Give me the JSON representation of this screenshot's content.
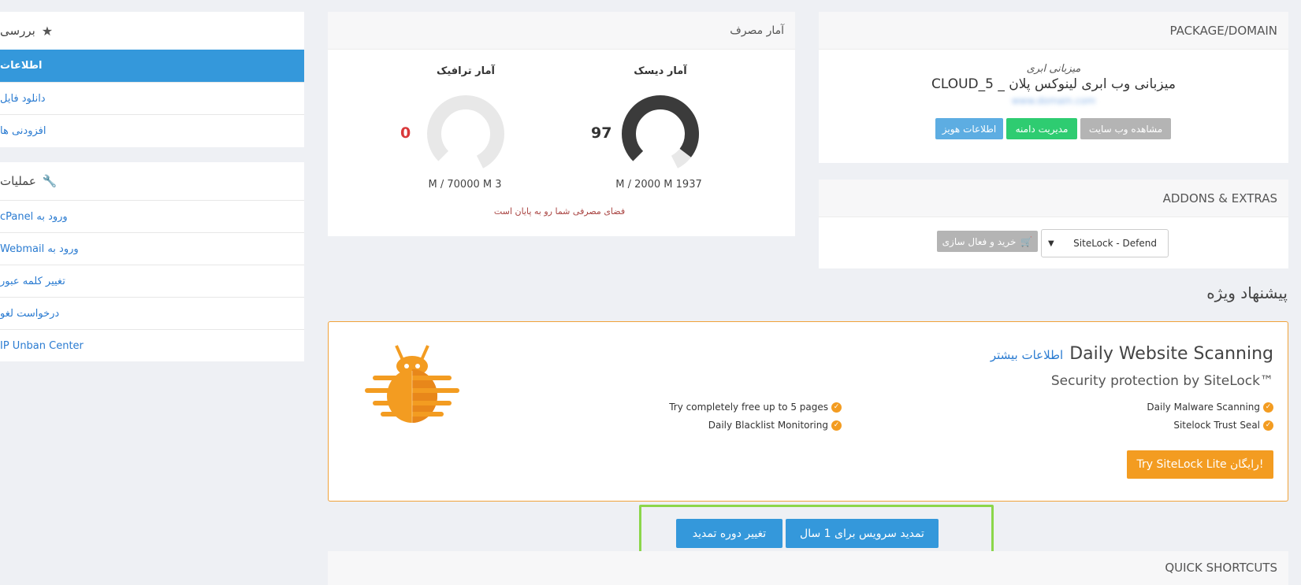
{
  "sidebar": {
    "overview_title": "بررسی",
    "overview_items": [
      {
        "label": "اطلاعات",
        "active": true
      },
      {
        "label": "دانلود فایل",
        "active": false
      },
      {
        "label": "افزودنی ها",
        "active": false
      }
    ],
    "actions_title": "عملیات",
    "action_items": [
      {
        "label": "ورود به cPanel"
      },
      {
        "label": "ورود به Webmail"
      },
      {
        "label": "تغییر کلمه عبور"
      },
      {
        "label": "درخواست لغو"
      },
      {
        "label": "IP Unban Center"
      }
    ]
  },
  "usage": {
    "title": "آمار مصرف",
    "disk": {
      "label": "آمار دیسک",
      "percent": 97,
      "value_text": "97",
      "detail": "M / 2000 M 1937"
    },
    "traffic": {
      "label": "آمار ترافیک",
      "percent": 0,
      "value_text": "0",
      "detail": "M / 70000 M 3"
    },
    "warning": "فضای مصرفی شما رو به پایان است"
  },
  "package": {
    "header": "PACKAGE/DOMAIN",
    "group": "میزبانی ابری",
    "name": "میزبانی وب ابری لینوکس پلان _ CLOUD_5",
    "domain_blurred": "www.domain.com",
    "buttons": {
      "view_site": "مشاهده وب سایت",
      "manage_domain": "مدیریت دامنه",
      "whois": "اطلاعات هویز"
    }
  },
  "addons": {
    "header": "ADDONS & EXTRAS",
    "select_value": "SiteLock - Defend",
    "buy_button": "خرید و فعال سازی"
  },
  "special_offer": {
    "title": "پیشنهاد ویژه",
    "heading": "Daily Website Scanning",
    "more_info": "اطلاعات بیشتر",
    "subheading": "Security protection by SiteLock™",
    "features_right": [
      "Daily Malware Scanning",
      "Sitelock Trust Seal"
    ],
    "features_left": [
      "Try completely free up to 5 pages",
      "Daily Blacklist Monitoring"
    ],
    "cta": "Try SiteLock Lite رایگان!"
  },
  "renew": {
    "renew_button": "تمدید سرویس برای 1 سال",
    "change_period_button": "تغییر دوره تمدید"
  },
  "shortcuts": {
    "header": "QUICK SHORTCUTS"
  },
  "colors": {
    "primary": "#3498db",
    "success": "#2ecc71",
    "muted": "#b4b4b4",
    "orange": "#f39c21",
    "danger": "#d9383a",
    "highlight": "#8bd64a"
  }
}
